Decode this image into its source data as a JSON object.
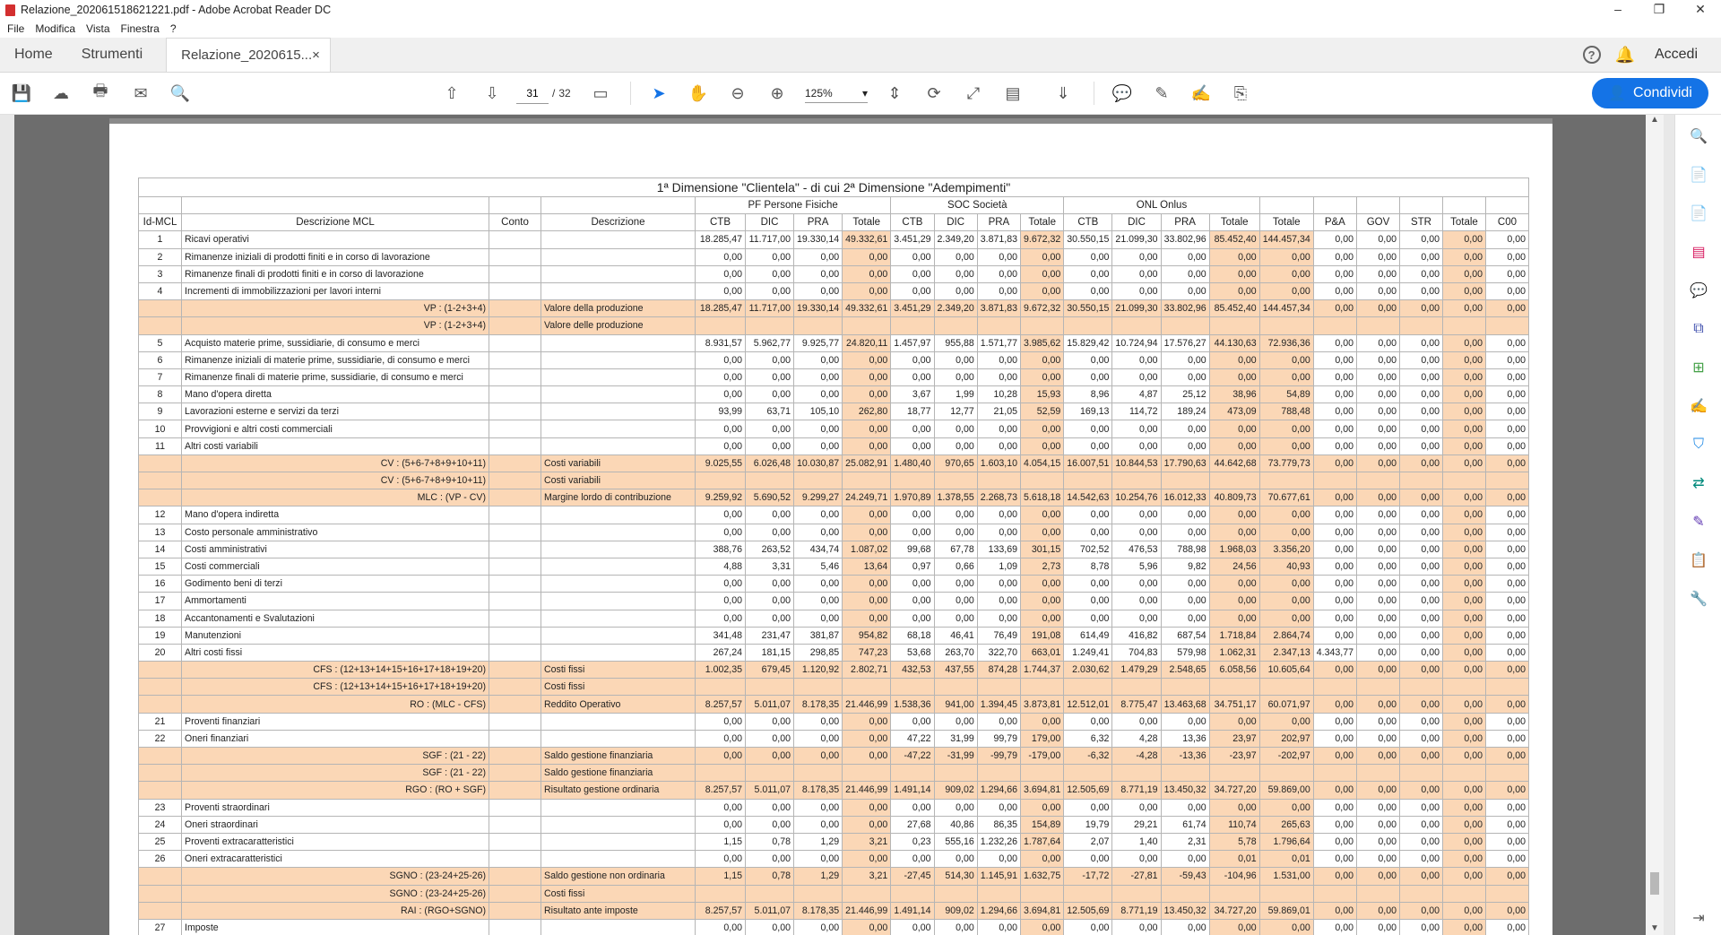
{
  "window": {
    "title": "Relazione_20206151​8621221.pdf - Adobe Acrobat Reader DC"
  },
  "menu": [
    "File",
    "Modifica",
    "Vista",
    "Finestra",
    "?"
  ],
  "tabs": {
    "home": "Home",
    "tools": "Strumenti",
    "doc": "Relazione_2020615...",
    "close": "×",
    "login": "Accedi",
    "help": "?"
  },
  "toolbar": {
    "page_current": "31",
    "page_sep": "/",
    "page_total": "32",
    "zoom": "125%",
    "share": "Condividi"
  },
  "icons": [
    "save-icon",
    "upload-icon",
    "print-icon",
    "mail-icon",
    "search-icon",
    "prev-page-icon",
    "next-page-icon",
    "view-mode-icon",
    "cursor-icon",
    "hand-icon",
    "zoom-out-icon",
    "zoom-in-icon",
    "fit-page-icon",
    "rotate-icon",
    "fullscreen-icon",
    "page-layout-icon",
    "scroll-icon",
    "comment-icon",
    "pen-icon",
    "sign-icon",
    "stamp-icon"
  ],
  "table": {
    "title": "1ª Dimensione \"Clientela\" - di cui 2ª Dimensione \"Adempimenti\"",
    "groups": [
      "PF Persone Fisiche",
      "SOC Società",
      "ONL Onlus"
    ],
    "headers": [
      "Id-MCL",
      "Descrizione MCL",
      "Conto",
      "Descrizione",
      "CTB",
      "DIC",
      "PRA",
      "Totale",
      "CTB",
      "DIC",
      "PRA",
      "Totale",
      "CTB",
      "DIC",
      "PRA",
      "Totale",
      "Totale",
      "P&A",
      "GOV",
      "STR",
      "Totale",
      "C00"
    ],
    "rows": [
      {
        "id": "1",
        "desc": "Ricavi operativi",
        "v": [
          "18.285,47",
          "11.717,00",
          "19.330,14",
          "49.332,61",
          "3.451,29",
          "2.349,20",
          "3.871,83",
          "9.672,32",
          "30.550,15",
          "21.099,30",
          "33.802,96",
          "85.452,40",
          "144.457,34",
          "0,00",
          "0,00",
          "0,00",
          "0,00",
          "0,00"
        ]
      },
      {
        "id": "2",
        "desc": "Rimanenze iniziali di prodotti finiti e in corso di lavorazione",
        "v": [
          "0,00",
          "0,00",
          "0,00",
          "0,00",
          "0,00",
          "0,00",
          "0,00",
          "0,00",
          "0,00",
          "0,00",
          "0,00",
          "0,00",
          "0,00",
          "0,00",
          "0,00",
          "0,00",
          "0,00",
          "0,00"
        ]
      },
      {
        "id": "3",
        "desc": "Rimanenze finali di prodotti finiti e in corso di lavorazione",
        "v": [
          "0,00",
          "0,00",
          "0,00",
          "0,00",
          "0,00",
          "0,00",
          "0,00",
          "0,00",
          "0,00",
          "0,00",
          "0,00",
          "0,00",
          "0,00",
          "0,00",
          "0,00",
          "0,00",
          "0,00",
          "0,00"
        ]
      },
      {
        "id": "4",
        "desc": "Incrementi di immobilizzazioni per lavori interni",
        "v": [
          "0,00",
          "0,00",
          "0,00",
          "0,00",
          "0,00",
          "0,00",
          "0,00",
          "0,00",
          "0,00",
          "0,00",
          "0,00",
          "0,00",
          "0,00",
          "0,00",
          "0,00",
          "0,00",
          "0,00",
          "0,00"
        ]
      },
      {
        "hl": true,
        "formula": "VP : (1-2+3+4)",
        "label": "Valore della produzione",
        "v": [
          "18.285,47",
          "11.717,00",
          "19.330,14",
          "49.332,61",
          "3.451,29",
          "2.349,20",
          "3.871,83",
          "9.672,32",
          "30.550,15",
          "21.099,30",
          "33.802,96",
          "85.452,40",
          "144.457,34",
          "0,00",
          "0,00",
          "0,00",
          "0,00",
          "0,00"
        ]
      },
      {
        "hl": true,
        "formula": "VP : (1-2+3+4)",
        "label": "Valore delle produzione",
        "v": []
      },
      {
        "id": "5",
        "desc": "Acquisto materie prime, sussidiarie, di consumo e merci",
        "v": [
          "8.931,57",
          "5.962,77",
          "9.925,77",
          "24.820,11",
          "1.457,97",
          "955,88",
          "1.571,77",
          "3.985,62",
          "15.829,42",
          "10.724,94",
          "17.576,27",
          "44.130,63",
          "72.936,36",
          "0,00",
          "0,00",
          "0,00",
          "0,00",
          "0,00"
        ]
      },
      {
        "id": "6",
        "desc": "Rimanenze iniziali di materie prime, sussidiarie, di consumo e merci",
        "v": [
          "0,00",
          "0,00",
          "0,00",
          "0,00",
          "0,00",
          "0,00",
          "0,00",
          "0,00",
          "0,00",
          "0,00",
          "0,00",
          "0,00",
          "0,00",
          "0,00",
          "0,00",
          "0,00",
          "0,00",
          "0,00"
        ]
      },
      {
        "id": "7",
        "desc": "Rimanenze finali di materie prime, sussidiarie, di consumo e merci",
        "v": [
          "0,00",
          "0,00",
          "0,00",
          "0,00",
          "0,00",
          "0,00",
          "0,00",
          "0,00",
          "0,00",
          "0,00",
          "0,00",
          "0,00",
          "0,00",
          "0,00",
          "0,00",
          "0,00",
          "0,00",
          "0,00"
        ]
      },
      {
        "id": "8",
        "desc": "Mano d'opera diretta",
        "v": [
          "0,00",
          "0,00",
          "0,00",
          "0,00",
          "3,67",
          "1,99",
          "10,28",
          "15,93",
          "8,96",
          "4,87",
          "25,12",
          "38,96",
          "54,89",
          "0,00",
          "0,00",
          "0,00",
          "0,00",
          "0,00"
        ]
      },
      {
        "id": "9",
        "desc": "Lavorazioni esterne e servizi da terzi",
        "v": [
          "93,99",
          "63,71",
          "105,10",
          "262,80",
          "18,77",
          "12,77",
          "21,05",
          "52,59",
          "169,13",
          "114,72",
          "189,24",
          "473,09",
          "788,48",
          "0,00",
          "0,00",
          "0,00",
          "0,00",
          "0,00"
        ]
      },
      {
        "id": "10",
        "desc": "Provvigioni e altri costi commerciali",
        "v": [
          "0,00",
          "0,00",
          "0,00",
          "0,00",
          "0,00",
          "0,00",
          "0,00",
          "0,00",
          "0,00",
          "0,00",
          "0,00",
          "0,00",
          "0,00",
          "0,00",
          "0,00",
          "0,00",
          "0,00",
          "0,00"
        ]
      },
      {
        "id": "11",
        "desc": "Altri costi variabili",
        "v": [
          "0,00",
          "0,00",
          "0,00",
          "0,00",
          "0,00",
          "0,00",
          "0,00",
          "0,00",
          "0,00",
          "0,00",
          "0,00",
          "0,00",
          "0,00",
          "0,00",
          "0,00",
          "0,00",
          "0,00",
          "0,00"
        ]
      },
      {
        "hl": true,
        "formula": "CV : (5+6-7+8+9+10+11)",
        "label": "Costi variabili",
        "v": [
          "9.025,55",
          "6.026,48",
          "10.030,87",
          "25.082,91",
          "1.480,40",
          "970,65",
          "1.603,10",
          "4.054,15",
          "16.007,51",
          "10.844,53",
          "17.790,63",
          "44.642,68",
          "73.779,73",
          "0,00",
          "0,00",
          "0,00",
          "0,00",
          "0,00"
        ]
      },
      {
        "hl": true,
        "formula": "CV : (5+6-7+8+9+10+11)",
        "label": "Costi variabili",
        "v": []
      },
      {
        "hl": true,
        "formula": "MLC : (VP - CV)",
        "label": "Margine lordo di contribuzione",
        "v": [
          "9.259,92",
          "5.690,52",
          "9.299,27",
          "24.249,71",
          "1.970,89",
          "1.378,55",
          "2.268,73",
          "5.618,18",
          "14.542,63",
          "10.254,76",
          "16.012,33",
          "40.809,73",
          "70.677,61",
          "0,00",
          "0,00",
          "0,00",
          "0,00",
          "0,00"
        ]
      },
      {
        "id": "12",
        "desc": "Mano d'opera indiretta",
        "v": [
          "0,00",
          "0,00",
          "0,00",
          "0,00",
          "0,00",
          "0,00",
          "0,00",
          "0,00",
          "0,00",
          "0,00",
          "0,00",
          "0,00",
          "0,00",
          "0,00",
          "0,00",
          "0,00",
          "0,00",
          "0,00"
        ]
      },
      {
        "id": "13",
        "desc": "Costo personale amministrativo",
        "v": [
          "0,00",
          "0,00",
          "0,00",
          "0,00",
          "0,00",
          "0,00",
          "0,00",
          "0,00",
          "0,00",
          "0,00",
          "0,00",
          "0,00",
          "0,00",
          "0,00",
          "0,00",
          "0,00",
          "0,00",
          "0,00"
        ]
      },
      {
        "id": "14",
        "desc": "Costi amministrativi",
        "v": [
          "388,76",
          "263,52",
          "434,74",
          "1.087,02",
          "99,68",
          "67,78",
          "133,69",
          "301,15",
          "702,52",
          "476,53",
          "788,98",
          "1.968,03",
          "3.356,20",
          "0,00",
          "0,00",
          "0,00",
          "0,00",
          "0,00"
        ]
      },
      {
        "id": "15",
        "desc": "Costi commerciali",
        "v": [
          "4,88",
          "3,31",
          "5,46",
          "13,64",
          "0,97",
          "0,66",
          "1,09",
          "2,73",
          "8,78",
          "5,96",
          "9,82",
          "24,56",
          "40,93",
          "0,00",
          "0,00",
          "0,00",
          "0,00",
          "0,00"
        ]
      },
      {
        "id": "16",
        "desc": "Godimento beni di terzi",
        "v": [
          "0,00",
          "0,00",
          "0,00",
          "0,00",
          "0,00",
          "0,00",
          "0,00",
          "0,00",
          "0,00",
          "0,00",
          "0,00",
          "0,00",
          "0,00",
          "0,00",
          "0,00",
          "0,00",
          "0,00",
          "0,00"
        ]
      },
      {
        "id": "17",
        "desc": "Ammortamenti",
        "v": [
          "0,00",
          "0,00",
          "0,00",
          "0,00",
          "0,00",
          "0,00",
          "0,00",
          "0,00",
          "0,00",
          "0,00",
          "0,00",
          "0,00",
          "0,00",
          "0,00",
          "0,00",
          "0,00",
          "0,00",
          "0,00"
        ]
      },
      {
        "id": "18",
        "desc": "Accantonamenti e Svalutazioni",
        "v": [
          "0,00",
          "0,00",
          "0,00",
          "0,00",
          "0,00",
          "0,00",
          "0,00",
          "0,00",
          "0,00",
          "0,00",
          "0,00",
          "0,00",
          "0,00",
          "0,00",
          "0,00",
          "0,00",
          "0,00",
          "0,00"
        ]
      },
      {
        "id": "19",
        "desc": "Manutenzioni",
        "v": [
          "341,48",
          "231,47",
          "381,87",
          "954,82",
          "68,18",
          "46,41",
          "76,49",
          "191,08",
          "614,49",
          "416,82",
          "687,54",
          "1.718,84",
          "2.864,74",
          "0,00",
          "0,00",
          "0,00",
          "0,00",
          "0,00"
        ]
      },
      {
        "id": "20",
        "desc": "Altri costi fissi",
        "v": [
          "267,24",
          "181,15",
          "298,85",
          "747,23",
          "53,68",
          "263,70",
          "322,70",
          "663,01",
          "1.249,41",
          "704,83",
          "579,98",
          "1.062,31",
          "2.347,13",
          "4.343,77",
          "0,00",
          "0,00",
          "0,00",
          "0,00"
        ]
      },
      {
        "hl": true,
        "formula": "CFS : (12+13+14+15+16+17+18+19+20)",
        "label": "Costi fissi",
        "v": [
          "1.002,35",
          "679,45",
          "1.120,92",
          "2.802,71",
          "432,53",
          "437,55",
          "874,28",
          "1.744,37",
          "2.030,62",
          "1.479,29",
          "2.548,65",
          "6.058,56",
          "10.605,64",
          "0,00",
          "0,00",
          "0,00",
          "0,00",
          "0,00"
        ]
      },
      {
        "hl": true,
        "formula": "CFS : (12+13+14+15+16+17+18+19+20)",
        "label": "Costi fissi",
        "v": []
      },
      {
        "hl": true,
        "formula": "RO : (MLC - CFS)",
        "label": "Reddito Operativo",
        "v": [
          "8.257,57",
          "5.011,07",
          "8.178,35",
          "21.446,99",
          "1.538,36",
          "941,00",
          "1.394,45",
          "3.873,81",
          "12.512,01",
          "8.775,47",
          "13.463,68",
          "34.751,17",
          "60.071,97",
          "0,00",
          "0,00",
          "0,00",
          "0,00",
          "0,00"
        ]
      },
      {
        "id": "21",
        "desc": "Proventi finanziari",
        "v": [
          "0,00",
          "0,00",
          "0,00",
          "0,00",
          "0,00",
          "0,00",
          "0,00",
          "0,00",
          "0,00",
          "0,00",
          "0,00",
          "0,00",
          "0,00",
          "0,00",
          "0,00",
          "0,00",
          "0,00",
          "0,00"
        ]
      },
      {
        "id": "22",
        "desc": "Oneri finanziari",
        "v": [
          "0,00",
          "0,00",
          "0,00",
          "0,00",
          "47,22",
          "31,99",
          "99,79",
          "179,00",
          "6,32",
          "4,28",
          "13,36",
          "23,97",
          "202,97",
          "0,00",
          "0,00",
          "0,00",
          "0,00",
          "0,00"
        ]
      },
      {
        "hl": true,
        "formula": "SGF : (21 - 22)",
        "label": "Saldo gestione finanziaria",
        "v": [
          "0,00",
          "0,00",
          "0,00",
          "0,00",
          "-47,22",
          "-31,99",
          "-99,79",
          "-179,00",
          "-6,32",
          "-4,28",
          "-13,36",
          "-23,97",
          "-202,97",
          "0,00",
          "0,00",
          "0,00",
          "0,00",
          "0,00"
        ]
      },
      {
        "hl": true,
        "formula": "SGF : (21 - 22)",
        "label": "Saldo gestione finanziaria",
        "v": []
      },
      {
        "hl": true,
        "formula": "RGO : (RO + SGF)",
        "label": "Risultato gestione ordinaria",
        "v": [
          "8.257,57",
          "5.011,07",
          "8.178,35",
          "21.446,99",
          "1.491,14",
          "909,02",
          "1.294,66",
          "3.694,81",
          "12.505,69",
          "8.771,19",
          "13.450,32",
          "34.727,20",
          "59.869,00",
          "0,00",
          "0,00",
          "0,00",
          "0,00",
          "0,00"
        ]
      },
      {
        "id": "23",
        "desc": "Proventi straordinari",
        "v": [
          "0,00",
          "0,00",
          "0,00",
          "0,00",
          "0,00",
          "0,00",
          "0,00",
          "0,00",
          "0,00",
          "0,00",
          "0,00",
          "0,00",
          "0,00",
          "0,00",
          "0,00",
          "0,00",
          "0,00",
          "0,00"
        ]
      },
      {
        "id": "24",
        "desc": "Oneri straordinari",
        "v": [
          "0,00",
          "0,00",
          "0,00",
          "0,00",
          "27,68",
          "40,86",
          "86,35",
          "154,89",
          "19,79",
          "29,21",
          "61,74",
          "110,74",
          "265,63",
          "0,00",
          "0,00",
          "0,00",
          "0,00",
          "0,00"
        ]
      },
      {
        "id": "25",
        "desc": "Proventi extracaratteristici",
        "v": [
          "1,15",
          "0,78",
          "1,29",
          "3,21",
          "0,23",
          "555,16",
          "1.232,26",
          "1.787,64",
          "2,07",
          "1,40",
          "2,31",
          "5,78",
          "1.796,64",
          "0,00",
          "0,00",
          "0,00",
          "0,00",
          "0,00"
        ]
      },
      {
        "id": "26",
        "desc": "Oneri extracaratteristici",
        "v": [
          "0,00",
          "0,00",
          "0,00",
          "0,00",
          "0,00",
          "0,00",
          "0,00",
          "0,00",
          "0,00",
          "0,00",
          "0,00",
          "0,01",
          "0,01",
          "0,00",
          "0,00",
          "0,00",
          "0,00",
          "0,00"
        ]
      },
      {
        "hl": true,
        "formula": "SGNO : (23-24+25-26)",
        "label": "Saldo gestione non ordinaria",
        "v": [
          "1,15",
          "0,78",
          "1,29",
          "3,21",
          "-27,45",
          "514,30",
          "1.145,91",
          "1.632,75",
          "-17,72",
          "-27,81",
          "-59,43",
          "-104,96",
          "1.531,00",
          "0,00",
          "0,00",
          "0,00",
          "0,00",
          "0,00"
        ]
      },
      {
        "hl": true,
        "formula": "SGNO : (23-24+25-26)",
        "label": "Costi fissi",
        "v": []
      },
      {
        "hl": true,
        "formula": "RAI : (RGO+SGNO)",
        "label": "Risultato ante imposte",
        "v": [
          "8.257,57",
          "5.011,07",
          "8.178,35",
          "21.446,99",
          "1.491,14",
          "909,02",
          "1.294,66",
          "3.694,81",
          "12.505,69",
          "8.771,19",
          "13.450,32",
          "34.727,20",
          "59.869,01",
          "0,00",
          "0,00",
          "0,00",
          "0,00",
          "0,00"
        ]
      },
      {
        "id": "27",
        "desc": "Imposte",
        "v": [
          "0,00",
          "0,00",
          "0,00",
          "0,00",
          "0,00",
          "0,00",
          "0,00",
          "0,00",
          "0,00",
          "0,00",
          "0,00",
          "0,00",
          "0,00",
          "0,00",
          "0,00",
          "0,00",
          "0,00",
          "0,00"
        ]
      }
    ]
  }
}
